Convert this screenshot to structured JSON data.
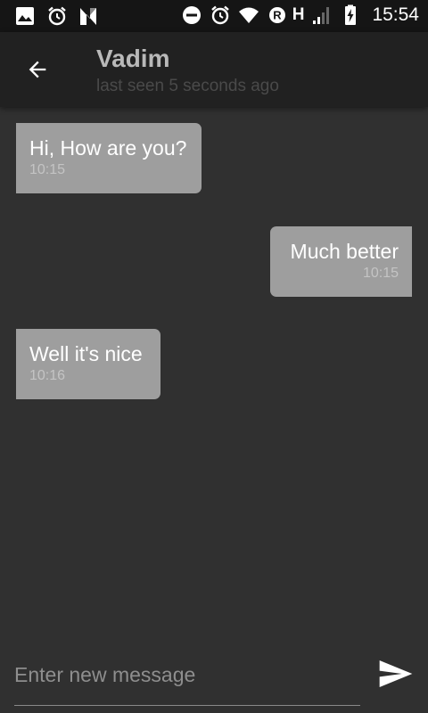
{
  "status_bar": {
    "left_icons": [
      "image-icon",
      "alarm-icon",
      "n-logo-icon"
    ],
    "right_icons": [
      "do-not-disturb-icon",
      "alarm-icon",
      "wifi-icon",
      "registered-icon",
      "signal-icon",
      "battery-charging-icon"
    ],
    "network_label": "H",
    "time": "15:54"
  },
  "app_bar": {
    "back_icon": "arrow-back-icon",
    "contact_name": "Vadim",
    "status": "last seen 5 seconds ago"
  },
  "messages": [
    {
      "direction": "incoming",
      "text": "Hi, How are you?",
      "time": "10:15"
    },
    {
      "direction": "outgoing",
      "text": "Much better",
      "time": "10:15"
    },
    {
      "direction": "incoming",
      "text": "Well it's nice",
      "time": "10:16"
    }
  ],
  "composer": {
    "placeholder": "Enter new message",
    "value": "",
    "send_icon": "send-icon"
  },
  "colors": {
    "background": "#303030",
    "app_bar": "#212121",
    "status_bar": "#151515",
    "bubble": "#9e9e9e"
  }
}
